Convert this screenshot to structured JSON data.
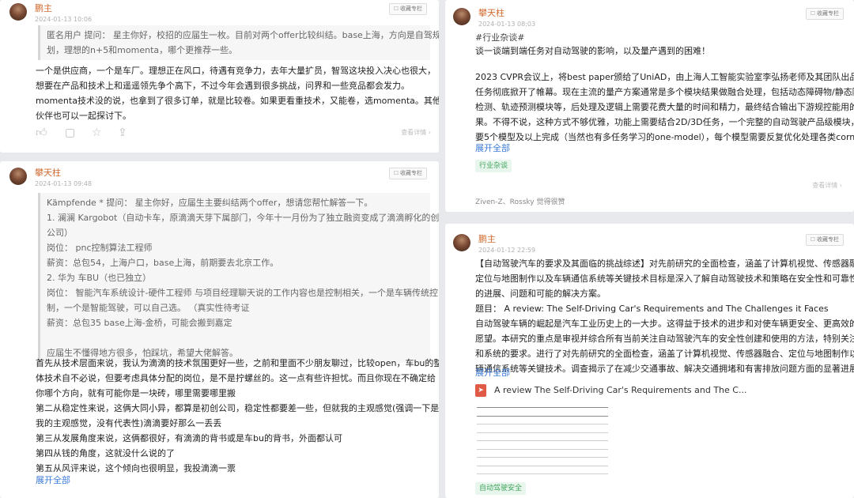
{
  "ui": {
    "fav_label": "收藏专栏",
    "detail_label": "查看详情 ›",
    "expand_label": "展开全部"
  },
  "post1": {
    "author": "鹏主",
    "time": "2024-01-13 10:06",
    "quote": [
      "匿名用户  提问：  星主你好，校招的应届生一枚。目前对两个offer比较纠结。base上海，方向是自驾规",
      "划，理想的n+5和momenta，哪个更推荐一些。"
    ],
    "body": [
      "一个是供应商，一个是车厂。理想正在风口，待遇有竞争力，去年大量扩员，智驾这块投入决心也很大，",
      "想要在产品和技术上和遥遥领先争个高下，不过今年会遇到很多挑战，问界和一些竞品都会发力。",
      "momenta技术没的说，也拿到了很多订单，就是比较卷。如果更看重技术，又能卷，选momenta。其他小",
      "伙伴也可以一起探讨下。"
    ]
  },
  "post2": {
    "author": "攀天柱",
    "time": "2024-01-13 09:48",
    "quote": [
      "Kämpfende *  提问：  星主你好，应届生主要纠结两个offer，想请您帮忙解答一下。",
      "1. 澜澜 Kargobot（自动卡车，原滴滴天芽下属部门，今年十一月份为了独立融资变成了滴滴孵化的创业",
      "公司）",
      "岗位：  pnc控制算法工程师",
      "薪资：总包54，上海户口，base上海，前期要去北京工作。",
      "2. 华为 车BU（也已独立）",
      "岗位：  智能汽车系统设计-硬件工程师 与项目经理聊天说的工作内容也是控制相关，一个是车辆传统控",
      "制，一个是智能驾驶，可以自己选。  （真实性待考证",
      "薪资：总包35 base上海-金桥，可能会搬到嘉定",
      "",
      "应届生不懂得地方很多，怕踩坑，希望大佬解答。"
    ],
    "body": [
      "首先从技术层面来说，我认为滴滴的技术氛围更好一些，之前和里面不少朋友聊过，比较open，车bu的整",
      "体技术自不必说，但要考虑具体分配的岗位，是不是拧螺丝的。这一点有些许担忧。而且你现在不确定给",
      "你哪个方向，就有可能你是一块砖，哪里需要哪里搬",
      "第二从稳定性来说，这俩大同小异，都算是初创公司，稳定性都要差一些，但就我的主观感觉(强调一下是",
      "我的主观感觉，没有代表性)滴滴要好那么一丢丢",
      "第三从发展角度来说，这俩都很好，有滴滴的背书或是车bu的背书，外面都认可",
      "第四从钱的角度，这就没什么说的了",
      "第五从风评来说，这个倾向也很明显，我投滴滴一票"
    ]
  },
  "post3": {
    "author": "攀天柱",
    "time": "2024-01-13 08:03",
    "hashtag": "#行业杂谈#",
    "intro": "谈一谈端到端任务对自动驾驶的影响，以及量产遇到的困难！",
    "body": [
      "2023 CVPR会议上，将best paper颁给了UniAD，由上海人工智能实验室李弘扬老师及其团队出品，端到端",
      "任务彻底掀开了帷幕。现在主流的量产方案通常是多个模块结果做融合处理，包括动态障碍物/静态障碍物",
      "检测、轨迹预测模块等，后处理及逻辑上需要花费大量的时间和精力，最终结合输出下游规控能用的结",
      "果。不得不说，这种方式不够优雅，功能上需要结合2D/3D任务，一个完整的自动驾驶产品级模块，至少需",
      "要5个模型及以上完成（当然也有多任务学习的one-model），每个模型需要反复优化处理各类corner"
    ],
    "tag": "行业杂谈",
    "likes": "Ziven-Z、Rossky 觉得很赞"
  },
  "post4": {
    "author": "鹏主",
    "time": "2024-01-12 22:59",
    "body": [
      "【自动驾驶汽车的要求及其面临的挑战综述】对先前研究的全面检查，涵盖了计算机视觉、传感器融合、",
      "定位与地图制作以及车辆通信系统等关键技术目标是深入了解自动驾驶技术和策略在安全性和可靠性方面",
      "的进展、问题和可能的解决方案。",
      "题目：  A review: The Self-Driving Car's Requirements and The Challenges it Faces",
      "自动驾驶车辆的崛起是汽车工业历史上的一大步。这得益于技术的进步和对使车辆更安全、更高效的共同",
      "愿望。本研究的重点是审视并综合所有当前关注自动驾驶汽车的安全性创建和使用的方法，特别关注软件",
      "和系统的要求。进行了对先前研究的全面检查，涵盖了计算机视觉、传感器融合、定位与地图制作以及车",
      "辆通信系统等关键技术。调查揭示了在减少交通事故、解决交通拥堵和有害排放问题方面的显著进展。然"
    ],
    "attachment_title": "A review The Self-Driving Car's Requirements and The C...",
    "tag": "自动驾驶安全"
  }
}
